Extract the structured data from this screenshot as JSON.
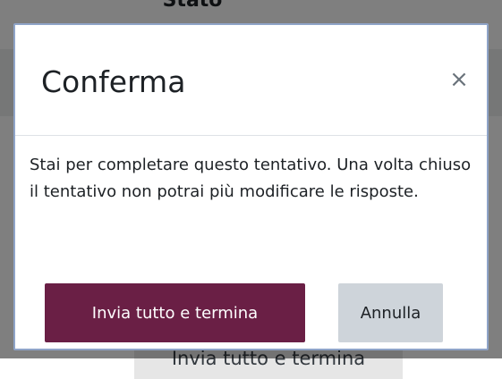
{
  "background": {
    "column_header": "Stato",
    "submit_button_label": "Invia tutto e termina"
  },
  "modal": {
    "title": "Conferma",
    "close_icon": "×",
    "body_text": "Stai per completare questo tentativo. Una volta chiuso il tentativo non potrai più modificare le risposte.",
    "primary_button_label": "Invia tutto e termina",
    "secondary_button_label": "Annulla"
  },
  "colors": {
    "primary_button_bg": "#6a1f45",
    "secondary_button_bg": "#ced4da",
    "modal_border": "#8fa4c8"
  }
}
